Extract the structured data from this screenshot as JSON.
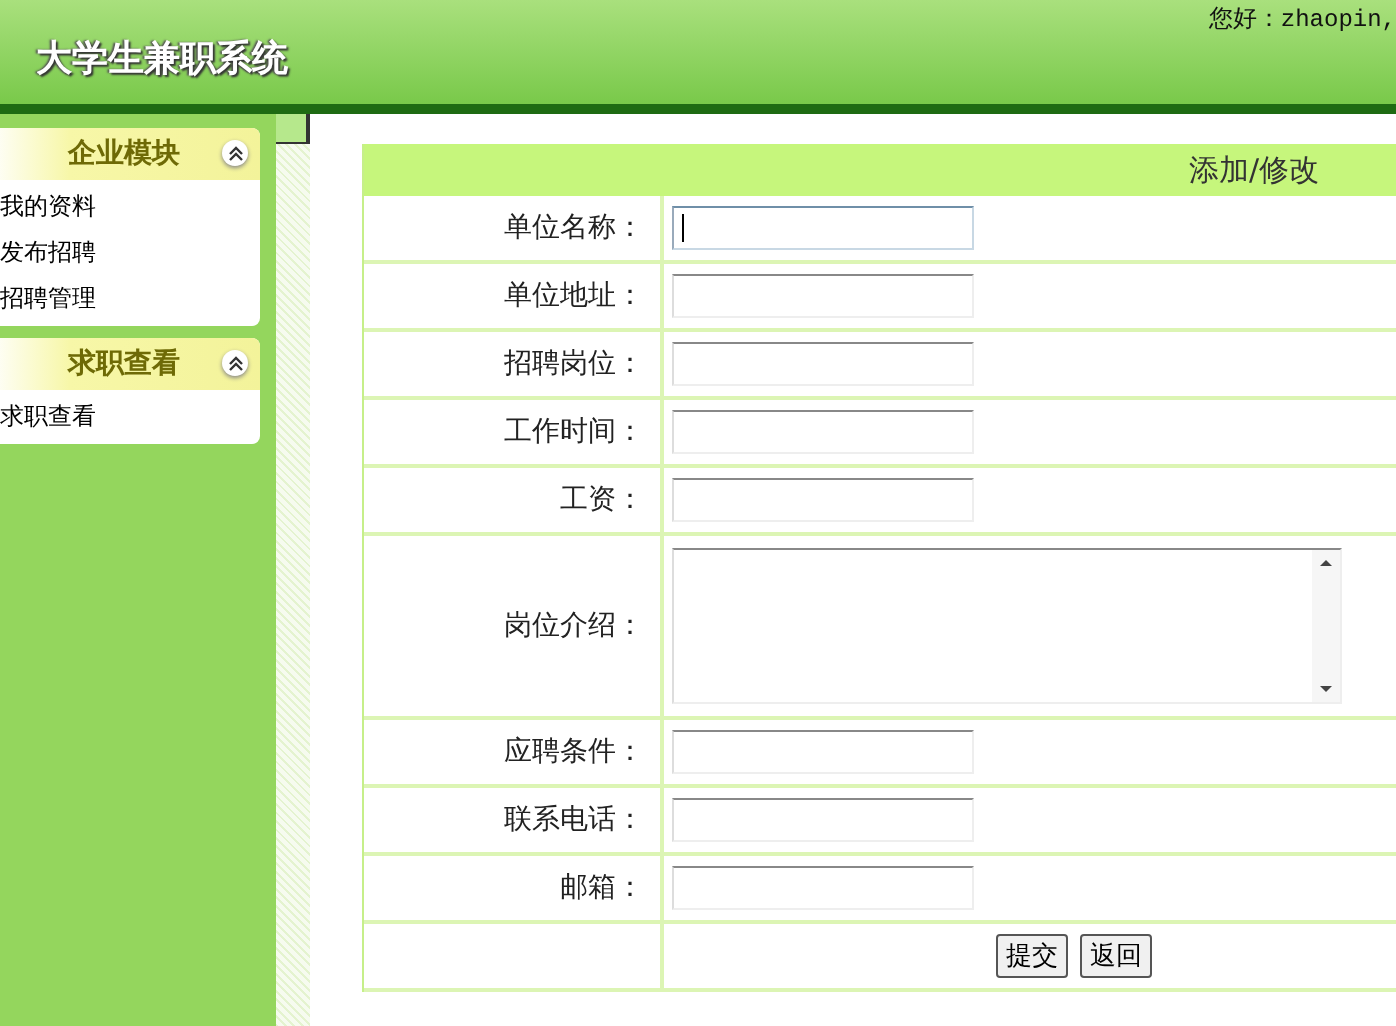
{
  "header": {
    "title": "大学生兼职系统",
    "greeting": "您好：zhaopin,"
  },
  "sidebar": {
    "panels": [
      {
        "title": "企业模块",
        "expanded": true,
        "items": [
          "我的资料",
          "发布招聘",
          "招聘管理"
        ]
      },
      {
        "title": "求职查看",
        "expanded": true,
        "items": [
          "求职查看"
        ]
      }
    ]
  },
  "form": {
    "title": "添加/修改",
    "fields": [
      {
        "label": "单位名称：",
        "kind": "text",
        "focused": true
      },
      {
        "label": "单位地址：",
        "kind": "text",
        "focused": false
      },
      {
        "label": "招聘岗位：",
        "kind": "text",
        "focused": false
      },
      {
        "label": "工作时间：",
        "kind": "text",
        "focused": false
      },
      {
        "label": "工资：",
        "kind": "text",
        "focused": false
      },
      {
        "label": "岗位介绍：",
        "kind": "textarea",
        "focused": false
      },
      {
        "label": "应聘条件：",
        "kind": "text",
        "focused": false
      },
      {
        "label": "联系电话：",
        "kind": "text",
        "focused": false
      },
      {
        "label": "邮箱：",
        "kind": "text",
        "focused": false
      }
    ],
    "buttons": [
      "提交",
      "返回"
    ]
  }
}
